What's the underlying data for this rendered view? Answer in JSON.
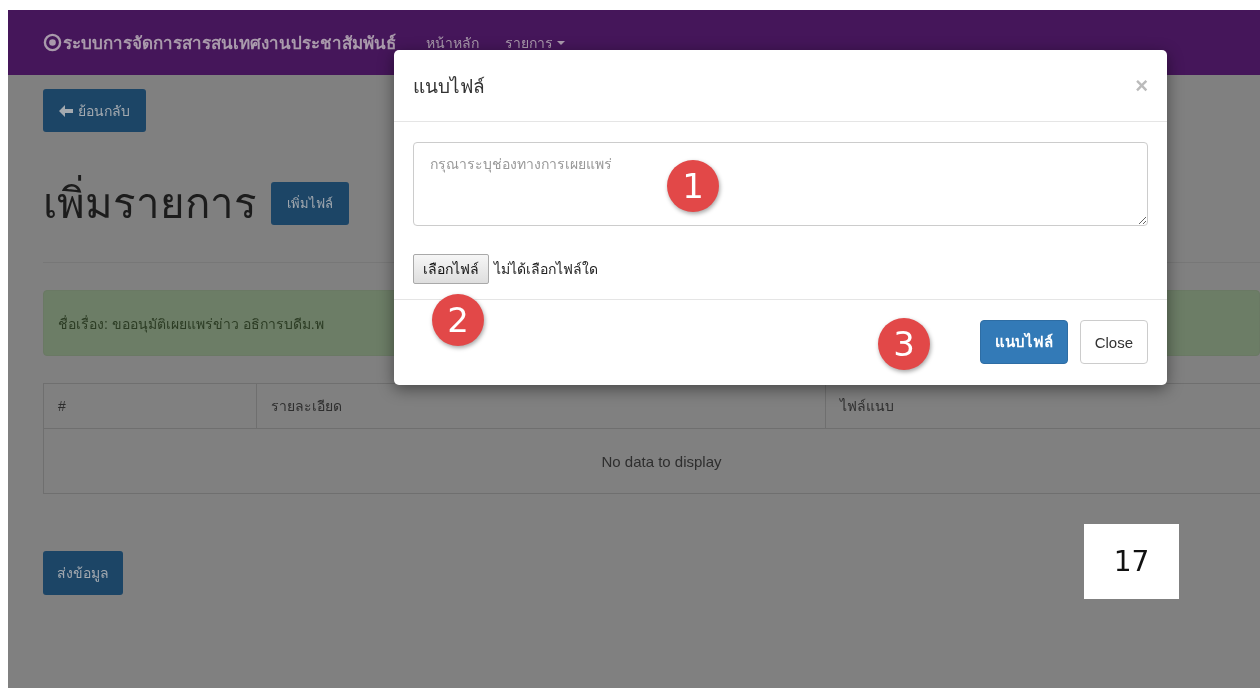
{
  "navbar": {
    "brand": "ระบบการจัดการสารสนเทศงานประชาสัมพันธ์",
    "links": [
      {
        "label": "หน้าหลัก",
        "kind": "link"
      },
      {
        "label": "รายการ",
        "kind": "dropdown"
      }
    ]
  },
  "back_button": "ย้อนกลับ",
  "heading": "เพิ่มรายการ",
  "add_file_button": "เพิ่มไฟล์",
  "alert": "ชื่อเรื่อง: ขออนุมัติเผยแพร่ข่าว อธิการบดีม.พ",
  "table": {
    "columns": [
      "#",
      "รายละเอียด",
      "ไฟล์แนบ"
    ],
    "empty_text": "No data to display"
  },
  "submit_button": "ส่งข้อมูล",
  "modal": {
    "title": "แนบไฟล์",
    "close_icon": "×",
    "textarea": {
      "placeholder": "กรุณาระบุช่องทางการเผยแพร่"
    },
    "file_button": "เลือกไฟล์",
    "file_status": "ไม่ได้เลือกไฟล์ใด",
    "buttons": [
      {
        "label": "แนบไฟล์",
        "kind": "primary"
      },
      {
        "label": "Close",
        "kind": "default"
      }
    ]
  },
  "step_markers": [
    "1",
    "2",
    "3"
  ],
  "page_number": "17"
}
